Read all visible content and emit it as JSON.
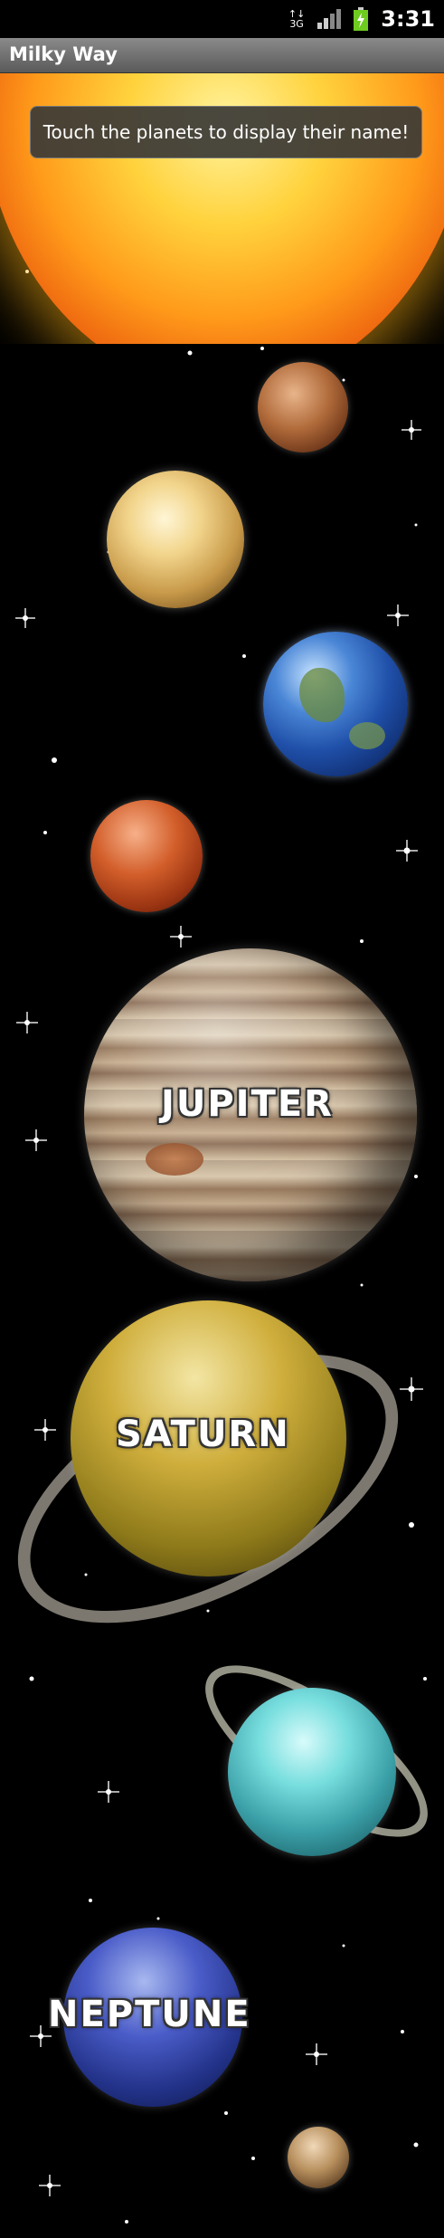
{
  "status_bar": {
    "network": "3G",
    "time": "3:31"
  },
  "app": {
    "title": "Milky Way"
  },
  "toast": {
    "message": "Touch the planets to display their name!"
  },
  "planet_labels": {
    "jupiter": "JUPITER",
    "saturn": "SATURN",
    "neptune": "NEPTUNE"
  },
  "colors": {
    "background": "#000000",
    "titlebar": "#6e6e6e",
    "toast": "#3c3a37"
  }
}
